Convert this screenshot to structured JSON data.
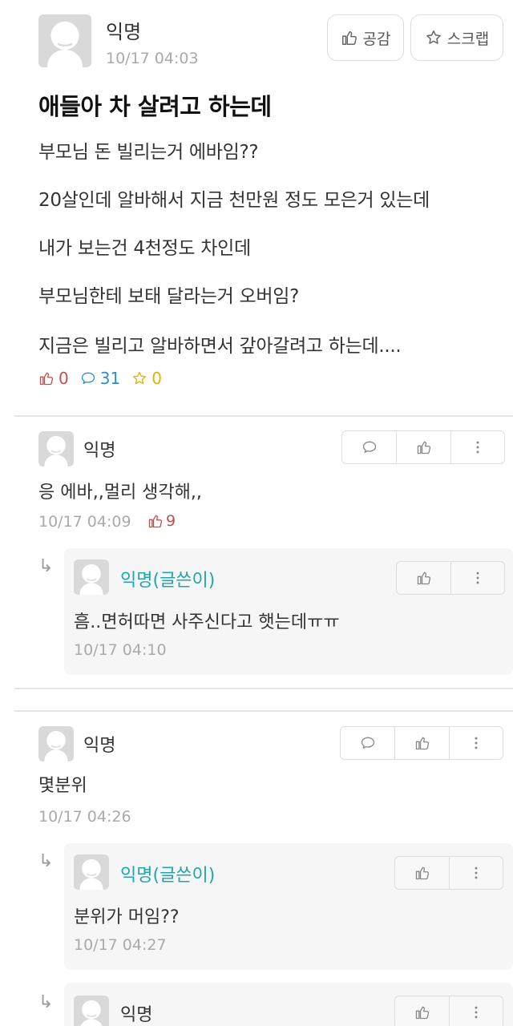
{
  "post": {
    "author": "익명",
    "date": "10/17 04:03",
    "like_button": "공감",
    "scrap_button": "스크랩",
    "title": "애들아 차 살려고 하는데",
    "body": [
      "부모님 돈 빌리는거 에바임??",
      "20살인데 알바해서 지금 천만원 정도 모은거 있는데",
      "내가 보는건 4천정도 차인데",
      "부모님한테 보태 달라는거 오버임?",
      "지금은 빌리고 알바하면서 갚아갈려고 하는데...."
    ],
    "stats": {
      "likes": "0",
      "comments": "31",
      "scraps": "0"
    }
  },
  "comments": [
    {
      "author": "익명",
      "text": "응 에바,,멀리 생각해,,",
      "date": "10/17 04:09",
      "likes": "9"
    },
    {
      "author": "익명(글쓴이)",
      "text": "흠..면허따면 사주신다고 햇는데ㅠㅠ",
      "date": "10/17 04:10"
    },
    {
      "author": "익명",
      "text": "몇분위",
      "date": "10/17 04:26"
    },
    {
      "author": "익명(글쓴이)",
      "text": "분위가 머임??",
      "date": "10/17 04:27"
    },
    {
      "author": "익명"
    }
  ],
  "icons": {
    "like": "thumbs-up-icon",
    "comment": "speech-bubble-icon",
    "star": "star-icon",
    "more": "more-vertical-icon",
    "reply": "reply-arrow-icon"
  },
  "colors": {
    "writer": "#20a6a6",
    "like": "#c0504d",
    "comment": "#2b8fc7",
    "scrap": "#e1b500"
  }
}
